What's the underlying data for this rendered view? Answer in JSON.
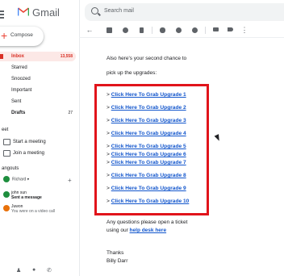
{
  "app": {
    "name": "Gmail"
  },
  "compose": {
    "label": "Compose"
  },
  "nav": [
    {
      "label": "Inbox",
      "count": "13,558",
      "active": true
    },
    {
      "label": "Starred",
      "count": ""
    },
    {
      "label": "Snoozed",
      "count": ""
    },
    {
      "label": "Important",
      "count": ""
    },
    {
      "label": "Sent",
      "count": ""
    },
    {
      "label": "Drafts",
      "count": "27"
    }
  ],
  "meet": {
    "heading": "eet",
    "items": [
      {
        "label": "Start a meeting",
        "icon": "video-icon"
      },
      {
        "label": "Join a meeting",
        "icon": "keyboard-icon"
      }
    ]
  },
  "hangouts": {
    "heading": "angouts",
    "user": "Richard",
    "chats": [
      {
        "name": "john sun",
        "message": "Sent a message",
        "color": "#1e8e3e"
      },
      {
        "name": "Juwon",
        "message": "You were on a video call",
        "color": "#e8710a"
      }
    ]
  },
  "search": {
    "placeholder": "Search mail"
  },
  "toolbar": {
    "icons": [
      "back-arrow-icon",
      "archive-icon",
      "report-spam-icon",
      "delete-icon",
      "mark-unread-icon",
      "snooze-icon",
      "add-task-icon",
      "move-to-icon",
      "label-icon",
      "more-icon"
    ]
  },
  "email": {
    "intro_line1": "Also here's your second chance to",
    "intro_line2": "pick up the upgrades:",
    "links": [
      "Click Here To Grab Upgrade 1",
      "Click Here To Grab Upgrade 2",
      "Click Here To Grab Upgrade 3",
      "Click Here To Grab Upgrade 4",
      "Click Here To Grab Upgrade 5",
      "Click Here To Grab Upgrade 6",
      "Click Here To Grab Upgrade 7",
      "Click Here To Grab Upgrade 8",
      "Click Here To Grab Upgrade 9",
      "Click Here To Grab Upgrade 10"
    ],
    "arrow": ">",
    "questions_line1": "Any questions please open a ticket",
    "questions_prefix": "using our ",
    "helpdesk_label": "help desk here",
    "thanks": "Thanks",
    "signature": "Billy Darr"
  },
  "colors": {
    "highlight_box": "#e1141b",
    "link": "#1155cc",
    "inbox_active": "#d93025"
  }
}
